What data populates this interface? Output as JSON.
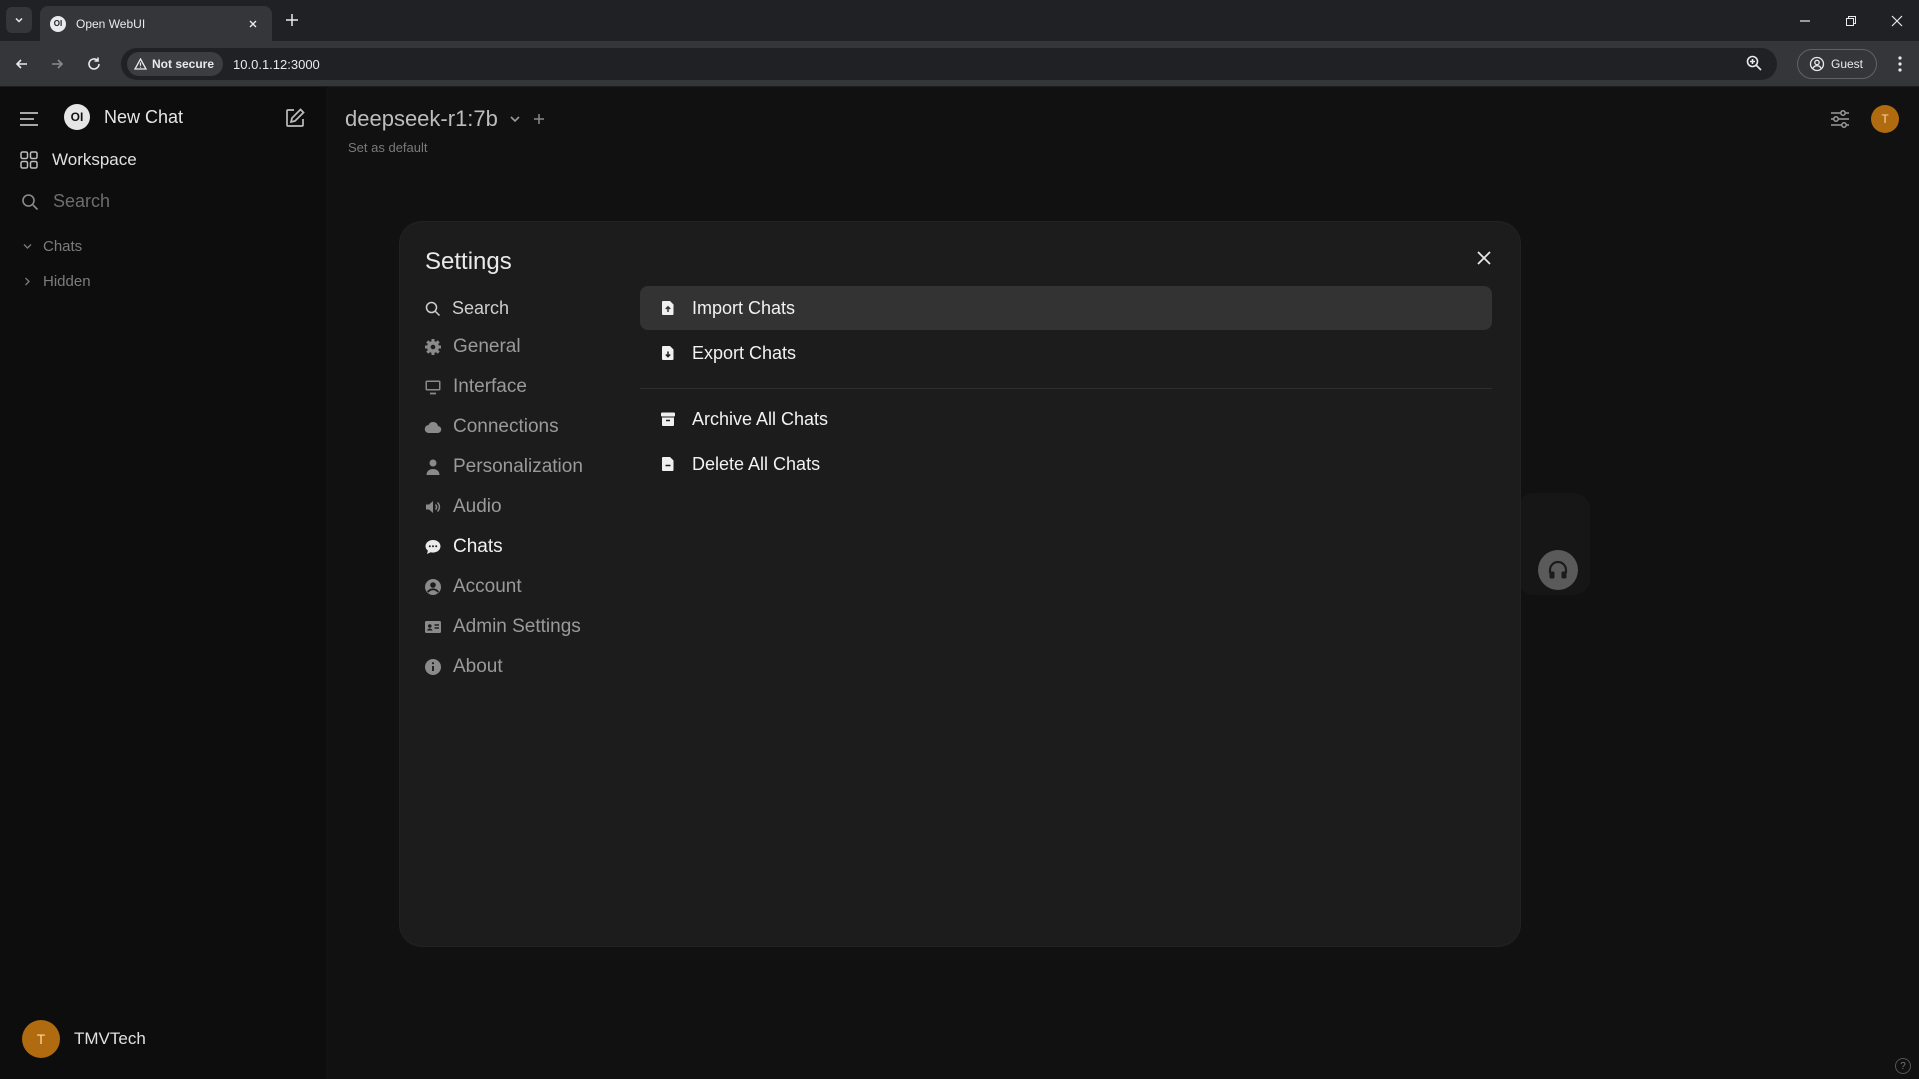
{
  "browser": {
    "tab_title": "Open WebUI",
    "tab_favicon": "OI",
    "security_chip": "Not secure",
    "url": "10.0.1.12:3000",
    "profile_label": "Guest"
  },
  "sidebar": {
    "logo_text": "OI",
    "new_chat": "New Chat",
    "workspace": "Workspace",
    "search_placeholder": "Search",
    "sections": [
      {
        "label": "Chats",
        "expanded": true
      },
      {
        "label": "Hidden",
        "expanded": false
      }
    ],
    "user_initial": "T",
    "user_name": "TMVTech"
  },
  "header": {
    "model_name": "deepseek-r1:7b",
    "set_default": "Set as default",
    "avatar_initial": "T"
  },
  "settings": {
    "title": "Settings",
    "search_label": "Search",
    "nav": [
      {
        "label": "General",
        "icon": "gear-icon"
      },
      {
        "label": "Interface",
        "icon": "monitor-icon"
      },
      {
        "label": "Connections",
        "icon": "cloud-icon"
      },
      {
        "label": "Personalization",
        "icon": "person-icon"
      },
      {
        "label": "Audio",
        "icon": "speaker-icon"
      },
      {
        "label": "Chats",
        "icon": "chat-bubble-icon",
        "active": true
      },
      {
        "label": "Account",
        "icon": "user-circle-icon"
      },
      {
        "label": "Admin Settings",
        "icon": "id-card-icon"
      },
      {
        "label": "About",
        "icon": "info-icon"
      }
    ],
    "actions": [
      {
        "label": "Import Chats",
        "icon": "file-upload-icon"
      },
      {
        "label": "Export Chats",
        "icon": "file-download-icon"
      },
      {
        "label": "Archive All Chats",
        "icon": "archive-box-icon"
      },
      {
        "label": "Delete All Chats",
        "icon": "file-minus-icon"
      }
    ]
  },
  "help_label": "?",
  "colors": {
    "modal_bg": "#1c1c1c",
    "hover_row": "#333333",
    "avatar": "#b06a10",
    "page_bg": "#111111"
  }
}
